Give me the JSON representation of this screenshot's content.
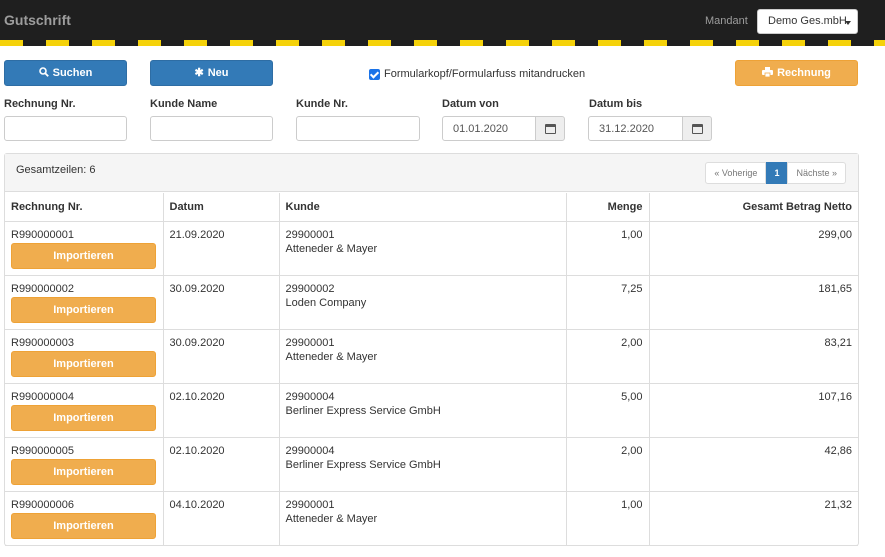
{
  "app": {
    "title": "Gutschrift",
    "mandant_label": "Mandant",
    "mandant_value": "Demo Ges.mbH"
  },
  "toolbar": {
    "search_label": "Suchen",
    "new_label": "Neu",
    "print_option_label": "Formularkopf/Formularfuss mitandrucken",
    "print_option_checked": true,
    "invoice_label": "Rechnung"
  },
  "filters": {
    "invoice_no": {
      "label": "Rechnung Nr.",
      "value": ""
    },
    "customer_name": {
      "label": "Kunde Name",
      "value": ""
    },
    "customer_no": {
      "label": "Kunde Nr.",
      "value": ""
    },
    "date_from": {
      "label": "Datum von",
      "value": "01.01.2020"
    },
    "date_to": {
      "label": "Datum bis",
      "value": "31.12.2020"
    }
  },
  "results": {
    "total_text": "Gesamtzeilen: 6",
    "pager": {
      "prev": "« Voherige",
      "current": "1",
      "next": "Nächste »"
    },
    "columns": [
      "Rechnung Nr.",
      "Datum",
      "Kunde",
      "Menge",
      "Gesamt Betrag Netto"
    ],
    "import_label": "Importieren",
    "rows": [
      {
        "invoice": "R990000001",
        "date": "21.09.2020",
        "customer_no": "29900001",
        "customer_name": "Atteneder & Mayer",
        "qty": "1,00",
        "net": "299,00"
      },
      {
        "invoice": "R990000002",
        "date": "30.09.2020",
        "customer_no": "29900002",
        "customer_name": "Loden Company",
        "qty": "7,25",
        "net": "181,65"
      },
      {
        "invoice": "R990000003",
        "date": "30.09.2020",
        "customer_no": "29900001",
        "customer_name": "Atteneder & Mayer",
        "qty": "2,00",
        "net": "83,21"
      },
      {
        "invoice": "R990000004",
        "date": "02.10.2020",
        "customer_no": "29900004",
        "customer_name": "Berliner Express Service GmbH",
        "qty": "5,00",
        "net": "107,16"
      },
      {
        "invoice": "R990000005",
        "date": "02.10.2020",
        "customer_no": "29900004",
        "customer_name": "Berliner Express Service GmbH",
        "qty": "2,00",
        "net": "42,86"
      },
      {
        "invoice": "R990000006",
        "date": "04.10.2020",
        "customer_no": "29900001",
        "customer_name": "Atteneder & Mayer",
        "qty": "1,00",
        "net": "21,32"
      }
    ]
  },
  "colors": {
    "topbar": "#1f1f1f",
    "stripe": "#f5d20a",
    "primary": "#337ab7",
    "warning": "#f0ad4e"
  },
  "icons": {
    "search": "search-icon",
    "new": "asterisk-icon",
    "print": "print-icon",
    "calendar": "calendar-icon"
  }
}
